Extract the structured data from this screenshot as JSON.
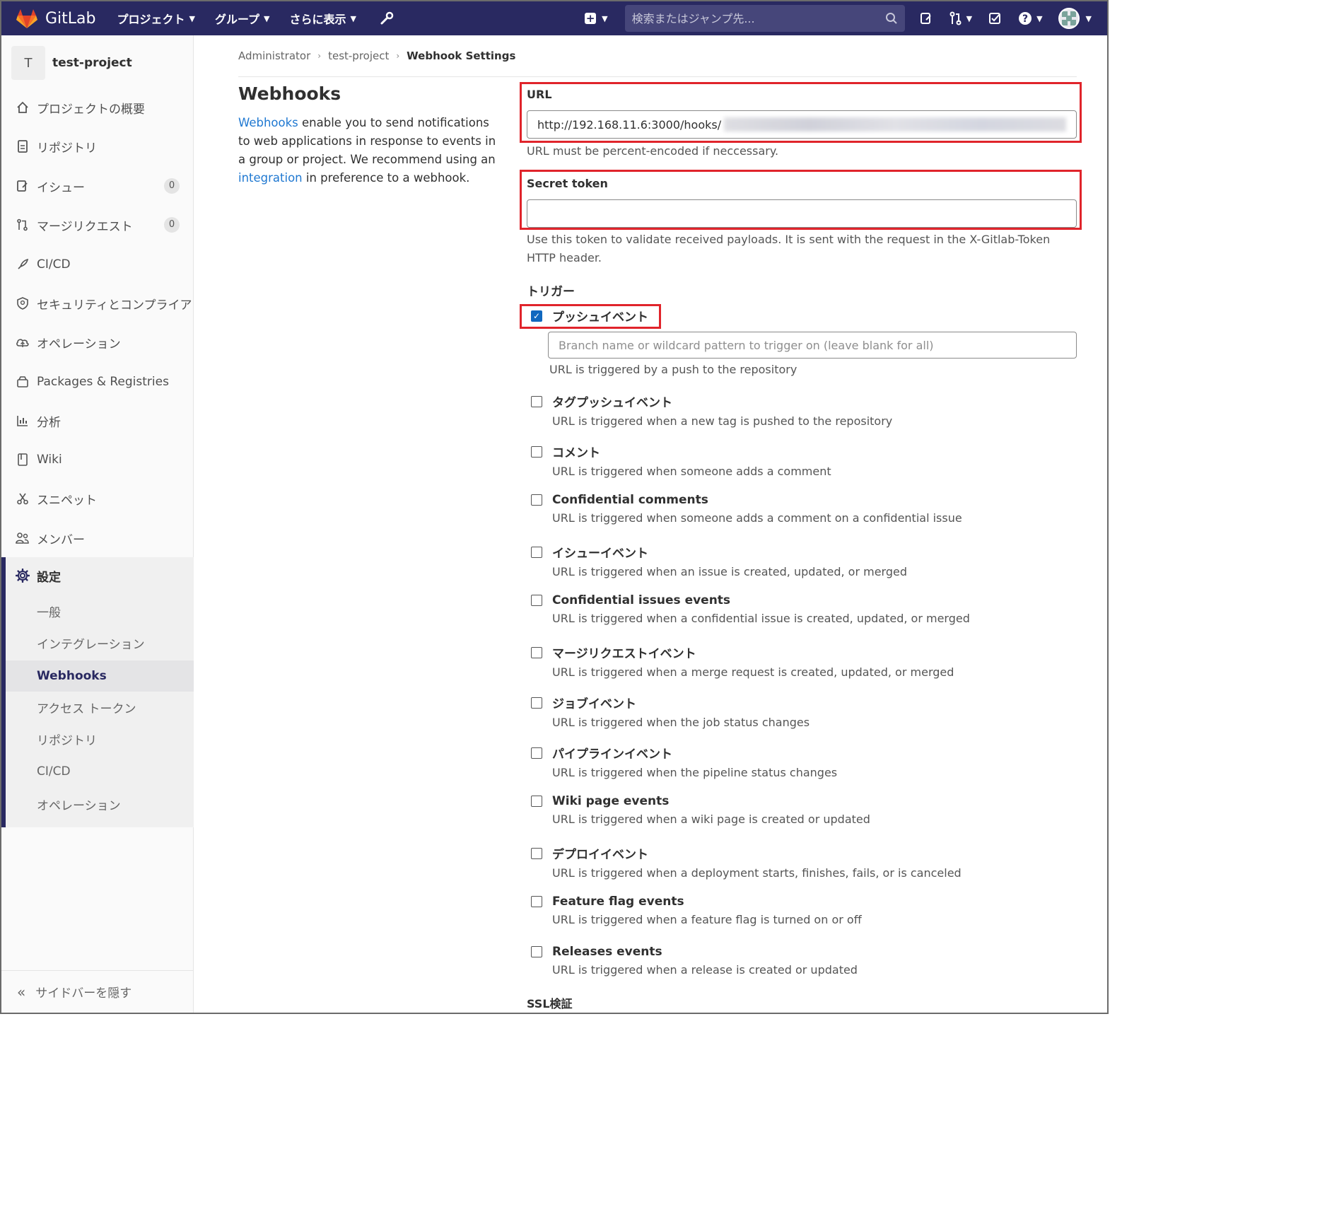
{
  "navbar": {
    "brand": "GitLab",
    "menu": [
      {
        "label": "プロジェクト",
        "icon": "chevron-down-icon"
      },
      {
        "label": "グループ",
        "icon": "chevron-down-icon"
      },
      {
        "label": "さらに表示",
        "icon": "chevron-down-icon"
      }
    ],
    "search_placeholder": "検索またはジャンプ先...",
    "icons": [
      "plus-icon",
      "issues-icon",
      "merge-requests-icon",
      "todo-icon",
      "help-icon",
      "avatar"
    ],
    "color": "#292961"
  },
  "sidebar": {
    "project_initial": "T",
    "project_name": "test-project",
    "items": [
      {
        "label": "プロジェクトの概要",
        "icon": "home-icon"
      },
      {
        "label": "リポジトリ",
        "icon": "doc-icon"
      },
      {
        "label": "イシュー",
        "icon": "issues-icon",
        "badge": "0"
      },
      {
        "label": "マージリクエスト",
        "icon": "merge-request-icon",
        "badge": "0"
      },
      {
        "label": "CI/CD",
        "icon": "rocket-icon"
      },
      {
        "label": "セキュリティとコンプライア",
        "icon": "shield-icon"
      },
      {
        "label": "オペレーション",
        "icon": "cloud-icon"
      },
      {
        "label": "Packages & Registries",
        "icon": "package-icon"
      },
      {
        "label": "分析",
        "icon": "chart-icon"
      },
      {
        "label": "Wiki",
        "icon": "book-icon"
      },
      {
        "label": "スニペット",
        "icon": "scissors-icon"
      },
      {
        "label": "メンバー",
        "icon": "users-icon"
      }
    ],
    "settings": {
      "label": "設定",
      "icon": "gear-icon",
      "sub_items": [
        "一般",
        "インテグレーション",
        "Webhooks",
        "アクセス トークン",
        "リポジトリ",
        "CI/CD",
        "オペレーション"
      ],
      "current": "Webhooks"
    },
    "collapse_label": "サイドバーを隠す"
  },
  "breadcrumb": [
    "Administrator",
    "test-project",
    "Webhook Settings"
  ],
  "intro": {
    "title": "Webhooks",
    "link_webhooks": "Webhooks",
    "text1": " enable you to send notifications to web applications in response to events in a group or project. We recommend using an ",
    "link_integration": "integration",
    "text2": " in preference to a webhook."
  },
  "form": {
    "url_label": "URL",
    "url_value": "http://192.168.11.6:3000/hooks/",
    "url_help": "URL must be percent-encoded if neccessary.",
    "token_label": "Secret token",
    "token_value": "",
    "token_help": "Use this token to validate received payloads. It is sent with the request in the X-Gitlab-Token HTTP header.",
    "trigger_title": "トリガー",
    "branch_placeholder": "Branch name or wildcard pattern to trigger on (leave blank for all)",
    "ssl_title": "SSL検証"
  },
  "triggers": [
    {
      "name": "プッシュイベント",
      "desc": "URL is triggered by a push to the repository",
      "checked": true
    },
    {
      "name": "タグプッシュイベント",
      "desc": "URL is triggered when a new tag is pushed to the repository",
      "checked": false
    },
    {
      "name": "コメント",
      "desc": "URL is triggered when someone adds a comment",
      "checked": false
    },
    {
      "name": "Confidential comments",
      "desc": "URL is triggered when someone adds a comment on a confidential issue",
      "checked": false
    },
    {
      "name": "イシューイベント",
      "desc": "URL is triggered when an issue is created, updated, or merged",
      "checked": false
    },
    {
      "name": "Confidential issues events",
      "desc": "URL is triggered when a confidential issue is created, updated, or merged",
      "checked": false
    },
    {
      "name": "マージリクエストイベント",
      "desc": "URL is triggered when a merge request is created, updated, or merged",
      "checked": false
    },
    {
      "name": "ジョブイベント",
      "desc": "URL is triggered when the job status changes",
      "checked": false
    },
    {
      "name": "パイプラインイベント",
      "desc": "URL is triggered when the pipeline status changes",
      "checked": false
    },
    {
      "name": "Wiki page events",
      "desc": "URL is triggered when a wiki page is created or updated",
      "checked": false
    },
    {
      "name": "デプロイイベント",
      "desc": "URL is triggered when a deployment starts, finishes, fails, or is canceled",
      "checked": false
    },
    {
      "name": "Feature flag events",
      "desc": "URL is triggered when a feature flag is turned on or off",
      "checked": false
    },
    {
      "name": "Releases events",
      "desc": "URL is triggered when a release is created or updated",
      "checked": false
    }
  ],
  "colors": {
    "link": "#1f78d1",
    "highlight": "#e0242b",
    "checkbox": "#1068bf"
  }
}
